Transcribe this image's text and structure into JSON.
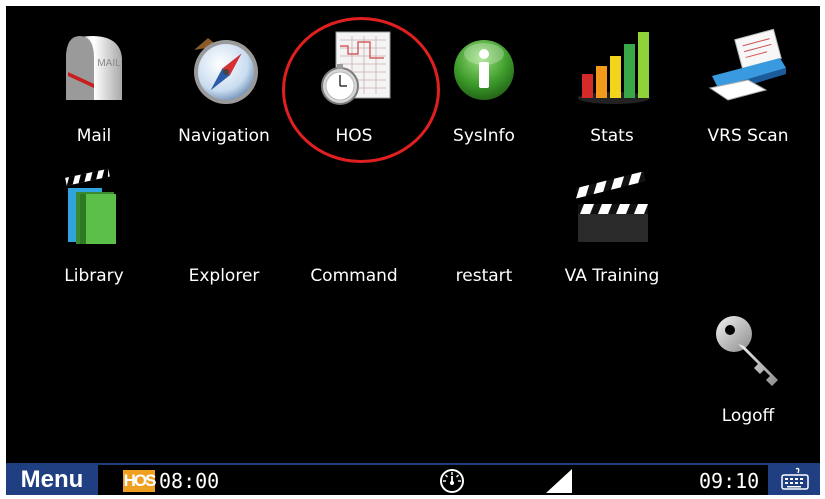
{
  "apps": [
    {
      "name": "mail",
      "label": "Mail",
      "icon": "mailbox-icon"
    },
    {
      "name": "navigation",
      "label": "Navigation",
      "icon": "compass-icon"
    },
    {
      "name": "hos",
      "label": "HOS",
      "icon": "stopwatch-logsheet-icon"
    },
    {
      "name": "sysinfo",
      "label": "SysInfo",
      "icon": "info-icon"
    },
    {
      "name": "stats",
      "label": "Stats",
      "icon": "bar-chart-icon"
    },
    {
      "name": "vrs-scan",
      "label": "VRS Scan",
      "icon": "scanner-icon"
    },
    {
      "name": "library",
      "label": "Library",
      "icon": "book-clapper-icon"
    },
    {
      "name": "explorer",
      "label": "Explorer",
      "icon": ""
    },
    {
      "name": "command",
      "label": "Command",
      "icon": ""
    },
    {
      "name": "restart",
      "label": "restart",
      "icon": ""
    },
    {
      "name": "va-training",
      "label": "VA Training",
      "icon": "clapperboard-icon"
    },
    {
      "name": "logoff",
      "label": "Logoff",
      "icon": "key-icon"
    }
  ],
  "taskbar": {
    "menu_label": "Menu",
    "hos_badge": "HOS",
    "hos_time": "08:00",
    "gauge_icon": "speedometer-icon",
    "signal_icon": "signal-strength-icon",
    "clock": "09:10",
    "keyboard_icon": "keyboard-icon"
  },
  "colors": {
    "highlight": "#e0201f",
    "taskbar_blue": "#1f3f82",
    "hos_orange": "#f0a020"
  }
}
